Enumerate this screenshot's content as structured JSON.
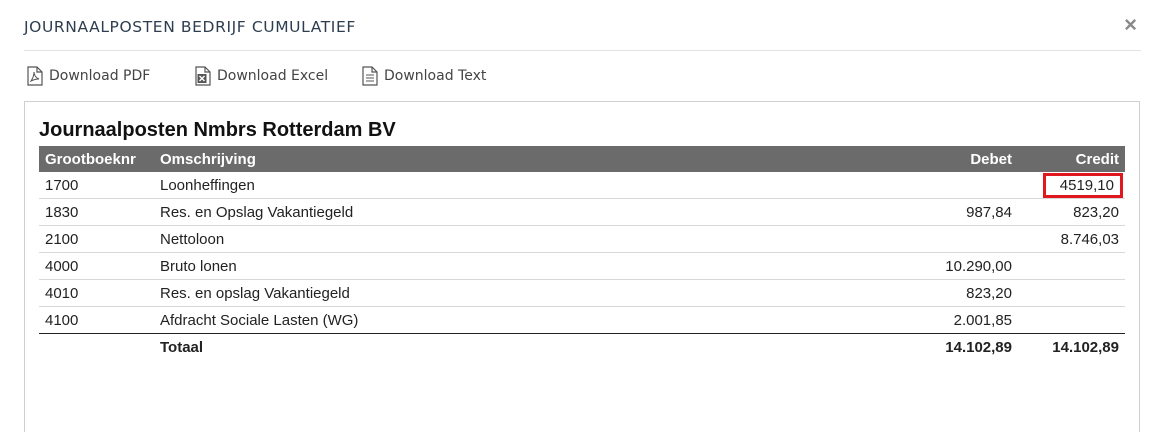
{
  "modal": {
    "title": "JOURNAALPOSTEN BEDRIJF CUMULATIEF",
    "close": "×"
  },
  "toolbar": {
    "pdf": "Download PDF",
    "excel": "Download Excel",
    "text": "Download Text"
  },
  "report": {
    "title": "Journaalposten Nmbrs Rotterdam BV",
    "headers": {
      "nr": "Grootboeknr",
      "desc": "Omschrijving",
      "debet": "Debet",
      "credit": "Credit"
    },
    "rows": [
      {
        "nr": "1700",
        "desc": "Loonheffingen",
        "debet": "",
        "credit": "4519,10"
      },
      {
        "nr": "1830",
        "desc": "Res. en Opslag Vakantiegeld",
        "debet": "987,84",
        "credit": "823,20"
      },
      {
        "nr": "2100",
        "desc": "Nettoloon",
        "debet": "",
        "credit": "8.746,03"
      },
      {
        "nr": "4000",
        "desc": "Bruto lonen",
        "debet": "10.290,00",
        "credit": ""
      },
      {
        "nr": "4010",
        "desc": "Res. en opslag Vakantiegeld",
        "debet": "823,20",
        "credit": ""
      },
      {
        "nr": "4100",
        "desc": "Afdracht Sociale Lasten (WG)",
        "debet": "2.001,85",
        "credit": ""
      }
    ],
    "total": {
      "label": "Totaal",
      "debet": "14.102,89",
      "credit": "14.102,89"
    }
  },
  "colors": {
    "header_bg": "#6b6b6b",
    "highlight": "#e0171f"
  }
}
